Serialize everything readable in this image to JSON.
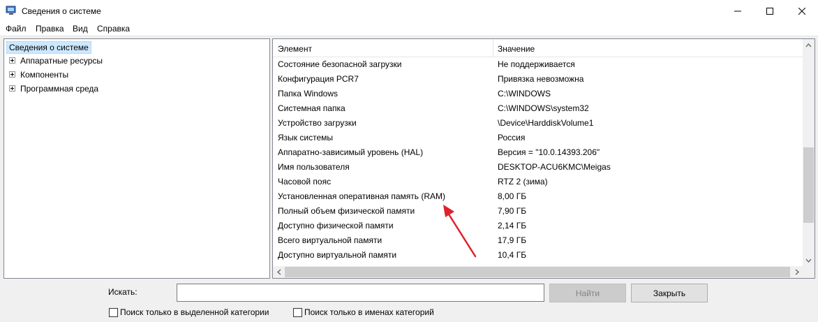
{
  "window": {
    "title": "Сведения о системе",
    "minimize_glyph": "—",
    "maximize_glyph": "☐",
    "close_glyph": "✕"
  },
  "menu": [
    "Файл",
    "Правка",
    "Вид",
    "Справка"
  ],
  "tree": {
    "root": "Сведения о системе",
    "children": [
      "Аппаратные ресурсы",
      "Компоненты",
      "Программная среда"
    ]
  },
  "table": {
    "columns": [
      "Элемент",
      "Значение"
    ],
    "rows": [
      {
        "name": "Состояние безопасной загрузки",
        "value": "Не поддерживается"
      },
      {
        "name": "Конфигурация PCR7",
        "value": "Привязка невозможна"
      },
      {
        "name": "Папка Windows",
        "value": "C:\\WINDOWS"
      },
      {
        "name": "Системная папка",
        "value": "C:\\WINDOWS\\system32"
      },
      {
        "name": "Устройство загрузки",
        "value": "\\Device\\HarddiskVolume1"
      },
      {
        "name": "Язык системы",
        "value": "Россия"
      },
      {
        "name": "Аппаратно-зависимый уровень (HAL)",
        "value": "Версия = \"10.0.14393.206\""
      },
      {
        "name": "Имя пользователя",
        "value": "DESKTOP-ACU6KMC\\Meigas"
      },
      {
        "name": "Часовой пояс",
        "value": "RTZ 2 (зима)"
      },
      {
        "name": "Установленная оперативная память (RAM)",
        "value": "8,00 ГБ"
      },
      {
        "name": "Полный объем физической памяти",
        "value": "7,90 ГБ"
      },
      {
        "name": "Доступно физической памяти",
        "value": "2,14 ГБ"
      },
      {
        "name": "Всего виртуальной памяти",
        "value": "17,9 ГБ"
      },
      {
        "name": "Доступно виртуальной памяти",
        "value": "10,4 ГБ"
      }
    ]
  },
  "search": {
    "label": "Искать:",
    "value": "",
    "find_button": "Найти",
    "close_button": "Закрыть",
    "check_selected_category": "Поиск только в выделенной категории",
    "check_category_names": "Поиск только в именах категорий"
  },
  "colors": {
    "annotation_arrow": "#e0202a",
    "selection": "#cce8ff"
  }
}
